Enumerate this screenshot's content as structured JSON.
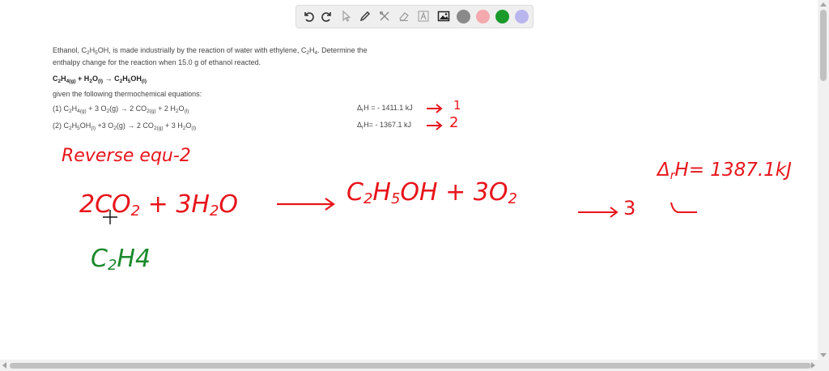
{
  "toolbar": {
    "tools": [
      "undo-icon",
      "redo-icon",
      "pointer-icon",
      "pen-icon",
      "tools-icon",
      "eraser-icon",
      "text-icon",
      "image-icon"
    ],
    "colors": [
      "#8a8a8a",
      "#f4a9ae",
      "#1a9a2b",
      "#b9b6ee"
    ]
  },
  "problem": {
    "line1": "Ethanol, C",
    "line1_sub1": "2",
    "line1_b": "H",
    "line1_sub2": "5",
    "line1_c": "OH, is made industrially by the reaction of water with ethylene, C",
    "line1_sub3": "2",
    "line1_d": "H",
    "line1_sub4": "4",
    "line1_e": ". Determine the",
    "line2": "enthalpy change for the reaction when 15.0 g of ethanol reacted.",
    "main_eq": {
      "a": "C",
      "a_sub": "2",
      "b": "H",
      "b_sub": "4(g)",
      "c": " + H",
      "c_sub": "2",
      "d": "O",
      "d_sub": "(l)",
      "e": "  →  C",
      "e_sub": "2",
      "f": "H",
      "f_sub": "5",
      "g": "OH",
      "g_sub": "(l)"
    },
    "given": "given the following thermochemical equations:",
    "eq1": {
      "a": "(1) C",
      "a_sub": "2",
      "b": "H",
      "b_sub": "4(g)",
      "c": " + 3 O",
      "c_sub": "2",
      "d": "(g) → 2 CO",
      "d_sub": "2(g)",
      "e": " + 2 H",
      "e_sub": "2",
      "f": "O",
      "f_sub": "(l)",
      "dh_a": "Δ",
      "dh_sub": "r",
      "dh_b": "H = - 1411.1 kJ"
    },
    "eq2": {
      "a": "(2) C",
      "a_sub": "2",
      "b": "H",
      "b_sub": "5",
      "c": "OH",
      "c_sub": "(l)",
      "d": " +3 O",
      "d_sub": "2",
      "e": "(g) → 2 CO",
      "e_sub": "2(g)",
      "f": " + 3 H",
      "f_sub": "2",
      "g": "O",
      "g_sub": "(l)",
      "dh_a": "Δ",
      "dh_sub": "r",
      "dh_b": "H= - 1367.1 kJ"
    }
  },
  "handwriting": {
    "arrow1_label": "1",
    "arrow2_label": "2",
    "reverse": "Reverse  equ-2",
    "eq_left": "2CO",
    "eq_left_sub": "2",
    "eq_mid": " + 3H",
    "eq_mid_sub": "2",
    "eq_mid2": "O",
    "eq_right": "C",
    "eq_right_sub1": "2",
    "eq_right2": "H",
    "eq_right_sub2": "5",
    "eq_right3": "OH + 3O",
    "eq_right_sub3": "2",
    "ref": "3",
    "dh": "Δ",
    "dh_sub": "r",
    "dh_val": "H= 1387.1kJ",
    "green": "C",
    "green_sub": "2",
    "green2": "H4"
  }
}
